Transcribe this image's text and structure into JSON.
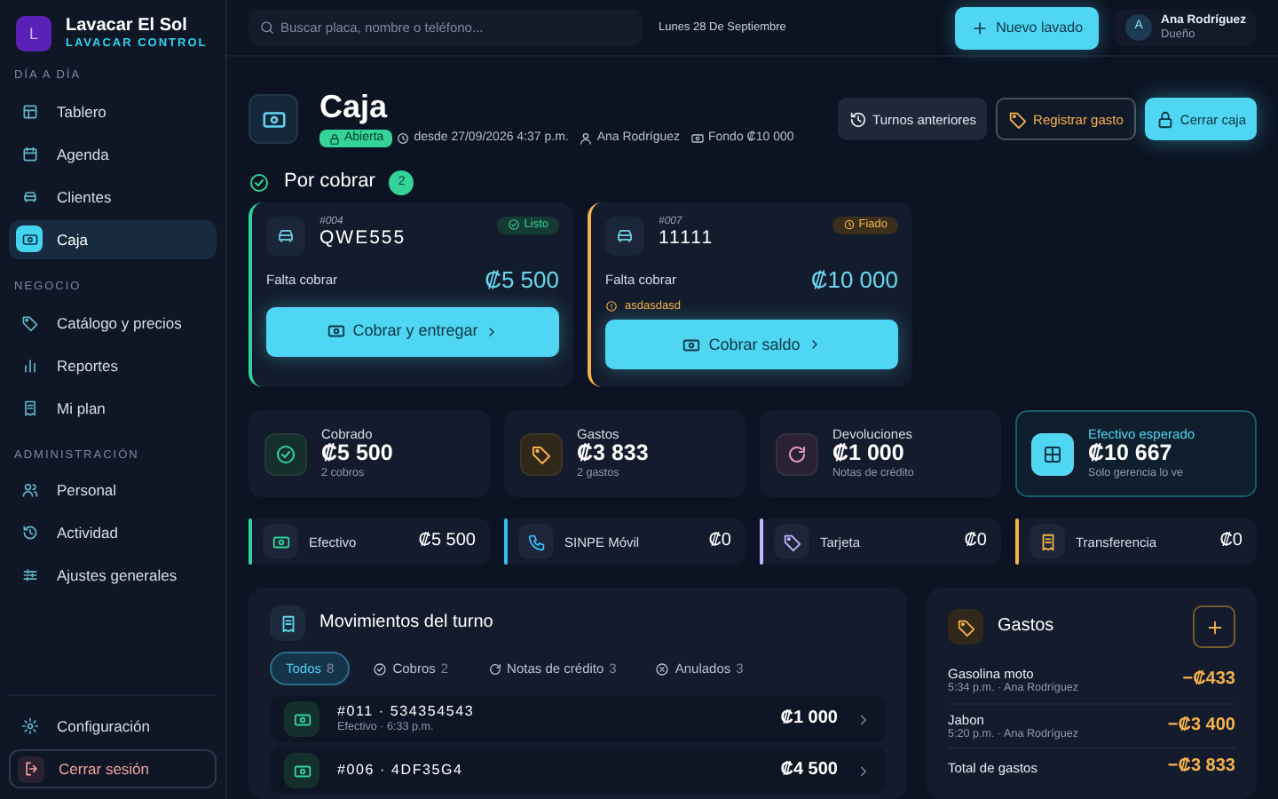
{
  "sidebar": {
    "brand": {
      "logo_letter": "L",
      "name": "Lavacar El Sol",
      "subtitle": "LAVACAR CONTROL"
    },
    "sections": [
      {
        "title": "DÍA A DÍA",
        "items": [
          {
            "label": "Tablero",
            "selected": false
          },
          {
            "label": "Agenda",
            "selected": false
          },
          {
            "label": "Clientes",
            "selected": false
          },
          {
            "label": "Caja",
            "selected": true
          }
        ]
      },
      {
        "title": "NEGOCIO",
        "items": [
          {
            "label": "Catálogo y precios",
            "selected": false
          },
          {
            "label": "Reportes",
            "selected": false
          },
          {
            "label": "Mi plan",
            "selected": false
          }
        ]
      },
      {
        "title": "ADMINISTRACIÓN",
        "items": [
          {
            "label": "Personal",
            "selected": false
          },
          {
            "label": "Actividad",
            "selected": false
          },
          {
            "label": "Ajustes generales",
            "selected": false
          }
        ]
      }
    ],
    "footer_items": [
      {
        "label": "Configuración",
        "kind": "settings"
      },
      {
        "label": "Cerrar sesión",
        "kind": "logout"
      }
    ]
  },
  "topbar": {
    "search": {
      "placeholder": "Buscar placa, nombre o teléfono..."
    },
    "date": "Lunes 28 De Septiembre",
    "new_button": "Nuevo lavado",
    "user": {
      "initial": "A",
      "name": "Ana Rodríguez",
      "role": "Dueño"
    }
  },
  "header": {
    "title": "Caja",
    "status": "Abierta",
    "since": "desde 27/09/2026 4:37 p.m.",
    "cashier": "Ana Rodríguez",
    "fund": "Fondo ₡10 000",
    "buttons": [
      {
        "label": "Turnos anteriores",
        "kind": "secondary"
      },
      {
        "label": "Registrar gasto",
        "kind": "warning"
      },
      {
        "label": "Cerrar caja",
        "kind": "primary"
      }
    ]
  },
  "pending": {
    "title": "Por cobrar",
    "count": "2",
    "cards": [
      {
        "number": "#004",
        "plate": "QWE555",
        "status": "Listo",
        "kind": "ready",
        "label": "Falta cobrar",
        "amount": "₡5 500",
        "button": "Cobrar y entregar"
      },
      {
        "number": "#007",
        "plate": "11111",
        "status": "Fiado",
        "kind": "credit",
        "label": "Falta cobrar",
        "amount": "₡10 000",
        "note": "asdasdasd",
        "button": "Cobrar saldo"
      }
    ]
  },
  "stats": [
    {
      "kind": "collected",
      "label": "Cobrado",
      "value": "₡5 500",
      "detail": "2 cobros",
      "highlighted": false
    },
    {
      "kind": "expenses",
      "label": "Gastos",
      "value": "₡3 833",
      "detail": "2 gastos",
      "highlighted": false
    },
    {
      "kind": "refunds",
      "label": "Devoluciones",
      "value": "₡1 000",
      "detail": "Notas de crédito",
      "highlighted": false
    },
    {
      "kind": "expected",
      "label": "Efectivo esperado",
      "value": "₡10 667",
      "detail": "Solo gerencia lo ve",
      "highlighted": true
    }
  ],
  "payment_methods": [
    {
      "name": "Efectivo",
      "amount": "₡5 500",
      "color": "#34d399"
    },
    {
      "name": "SINPE Móvil",
      "amount": "₡0",
      "color": "#38bdf8"
    },
    {
      "name": "Tarjeta",
      "amount": "₡0",
      "color": "#c4b5fd"
    },
    {
      "name": "Transferencia",
      "amount": "₡0",
      "color": "#f5b14c"
    }
  ],
  "movements": {
    "title": "Movimientos del turno",
    "filters": [
      {
        "label": "Todos",
        "count": "8",
        "selected": true
      },
      {
        "label": "Cobros",
        "count": "2",
        "selected": false
      },
      {
        "label": "Notas de crédito",
        "count": "3",
        "selected": false
      },
      {
        "label": "Anulados",
        "count": "3",
        "selected": false
      }
    ],
    "rows": [
      {
        "title": "#011 · 534354543",
        "detail": "Efectivo · 6:33 p.m.",
        "amount": "₡1 000"
      },
      {
        "title": "#006 · 4DF35G4",
        "amount": "₡4 500"
      }
    ]
  },
  "expenses": {
    "title": "Gastos",
    "items": [
      {
        "name": "Gasolina moto",
        "detail": "5:34 p.m. · Ana Rodríguez",
        "amount": "−₡433"
      },
      {
        "name": "Jabon",
        "detail": "5:20 p.m. · Ana Rodríguez",
        "amount": "−₡3 400"
      }
    ],
    "total_label": "Total de gastos",
    "total": "−₡3 833"
  }
}
